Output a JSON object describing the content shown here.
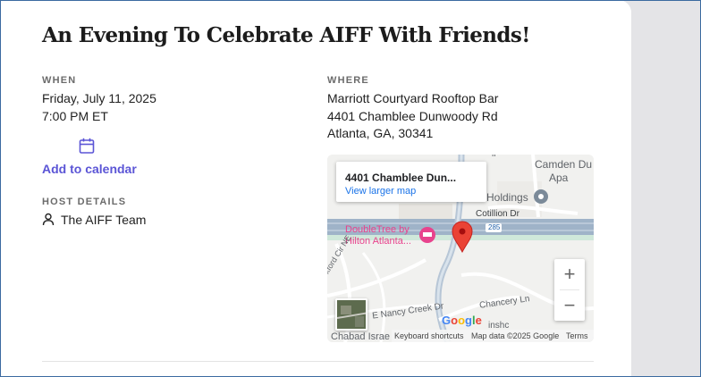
{
  "event": {
    "title": "An Evening To Celebrate AIFF With Friends!"
  },
  "when": {
    "label": "WHEN",
    "date": "Friday, July 11, 2025",
    "time": "7:00 PM ET",
    "icon": "calendar-icon",
    "add_to_calendar": "Add to calendar"
  },
  "host": {
    "label": "HOST DETAILS",
    "icon": "person-icon",
    "name": "The AIFF Team"
  },
  "where": {
    "label": "WHERE",
    "venue": "Marriott Courtyard Rooftop Bar",
    "street": "4401 Chamblee Dunwoody Rd",
    "city": "Atlanta, GA, 30341"
  },
  "map": {
    "info_title": "4401 Chamblee Dun...",
    "view_larger": "View larger map",
    "places": {
      "camden": "Camden Du",
      "apa": "Apa",
      "holdings": "Holdings",
      "cotillion": "Cotillion Dr",
      "route": "285",
      "doubletree_1": "DoubleTree by",
      "doubletree_2": "Hilton Atlanta...",
      "cir": "kford Cir NE",
      "chancery": "Chancery Ln",
      "nancy": "E Nancy Creek Dr",
      "chabad": "Chabad Israe",
      "insho": "inshc",
      "street_top": "ll"
    },
    "zoom_in": "+",
    "zoom_out": "−",
    "google": "Google",
    "attribution": {
      "shortcuts": "Keyboard shortcuts",
      "data": "Map data ©2025 Google",
      "terms": "Terms"
    },
    "colors": {
      "marker": "#ea4335",
      "hotel_pin": "#e8438d",
      "highway": "#9fb3c8",
      "link": "#1a73e8"
    }
  },
  "colors": {
    "accent": "#5b55d6",
    "text": "#1f1f1f",
    "muted": "#6b6b6b"
  }
}
